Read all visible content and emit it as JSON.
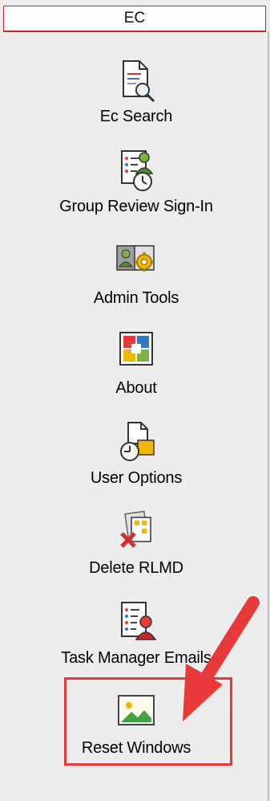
{
  "panel": {
    "title": "EC",
    "items": [
      {
        "label": "Ec Search",
        "icon": "document-search-icon"
      },
      {
        "label": "Group Review Sign-In",
        "icon": "user-list-clock-icon"
      },
      {
        "label": "Admin Tools",
        "icon": "admin-gear-icon"
      },
      {
        "label": "About",
        "icon": "colored-windows-icon"
      },
      {
        "label": "User Options",
        "icon": "document-clock-icon"
      },
      {
        "label": "Delete RLMD",
        "icon": "delete-document-icon"
      },
      {
        "label": "Task Manager Emails",
        "icon": "task-list-user-icon"
      },
      {
        "label": "Reset Windows",
        "icon": "landscape-picture-icon"
      }
    ]
  },
  "colors": {
    "accent": "#e8393a",
    "background": "#ececec"
  }
}
